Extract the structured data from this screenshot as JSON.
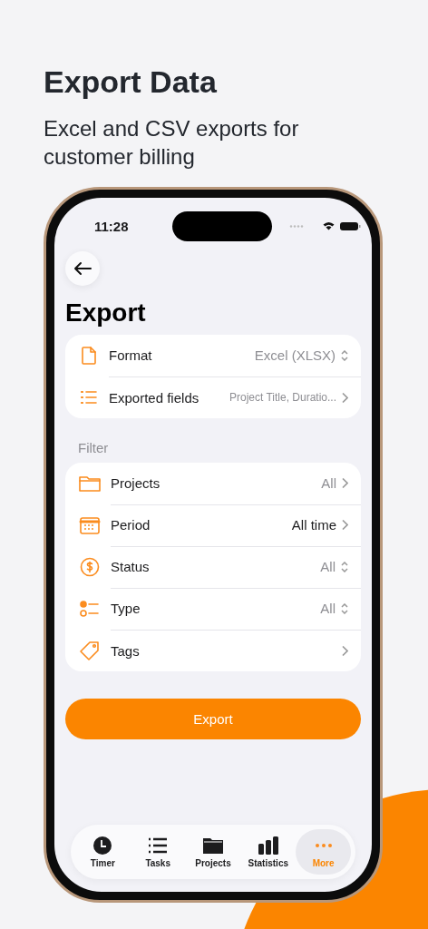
{
  "headline": "Export Data",
  "subtitle": "Excel and CSV exports for customer billing",
  "status_bar": {
    "time": "11:28"
  },
  "screen": {
    "title": "Export"
  },
  "format_section": {
    "rows": [
      {
        "label": "Format",
        "value": "Excel (XLSX)",
        "kind": "updown",
        "small": false,
        "active": false
      },
      {
        "label": "Exported fields",
        "value": "Project Title, Duratio...",
        "kind": "chevron",
        "small": true,
        "active": false
      }
    ]
  },
  "filter_section": {
    "heading": "Filter",
    "rows": [
      {
        "label": "Projects",
        "value": "All",
        "kind": "chevron",
        "small": false,
        "active": false
      },
      {
        "label": "Period",
        "value": "All time",
        "kind": "chevron",
        "small": false,
        "active": true
      },
      {
        "label": "Status",
        "value": "All",
        "kind": "updown",
        "small": false,
        "active": false
      },
      {
        "label": "Type",
        "value": "All",
        "kind": "updown",
        "small": false,
        "active": false
      },
      {
        "label": "Tags",
        "kind": "chevron"
      }
    ]
  },
  "export_button": "Export",
  "tabs": [
    {
      "label": "Timer",
      "selected": false
    },
    {
      "label": "Tasks",
      "selected": false
    },
    {
      "label": "Projects",
      "selected": false
    },
    {
      "label": "Statistics",
      "selected": false
    },
    {
      "label": "More",
      "selected": true
    }
  ]
}
